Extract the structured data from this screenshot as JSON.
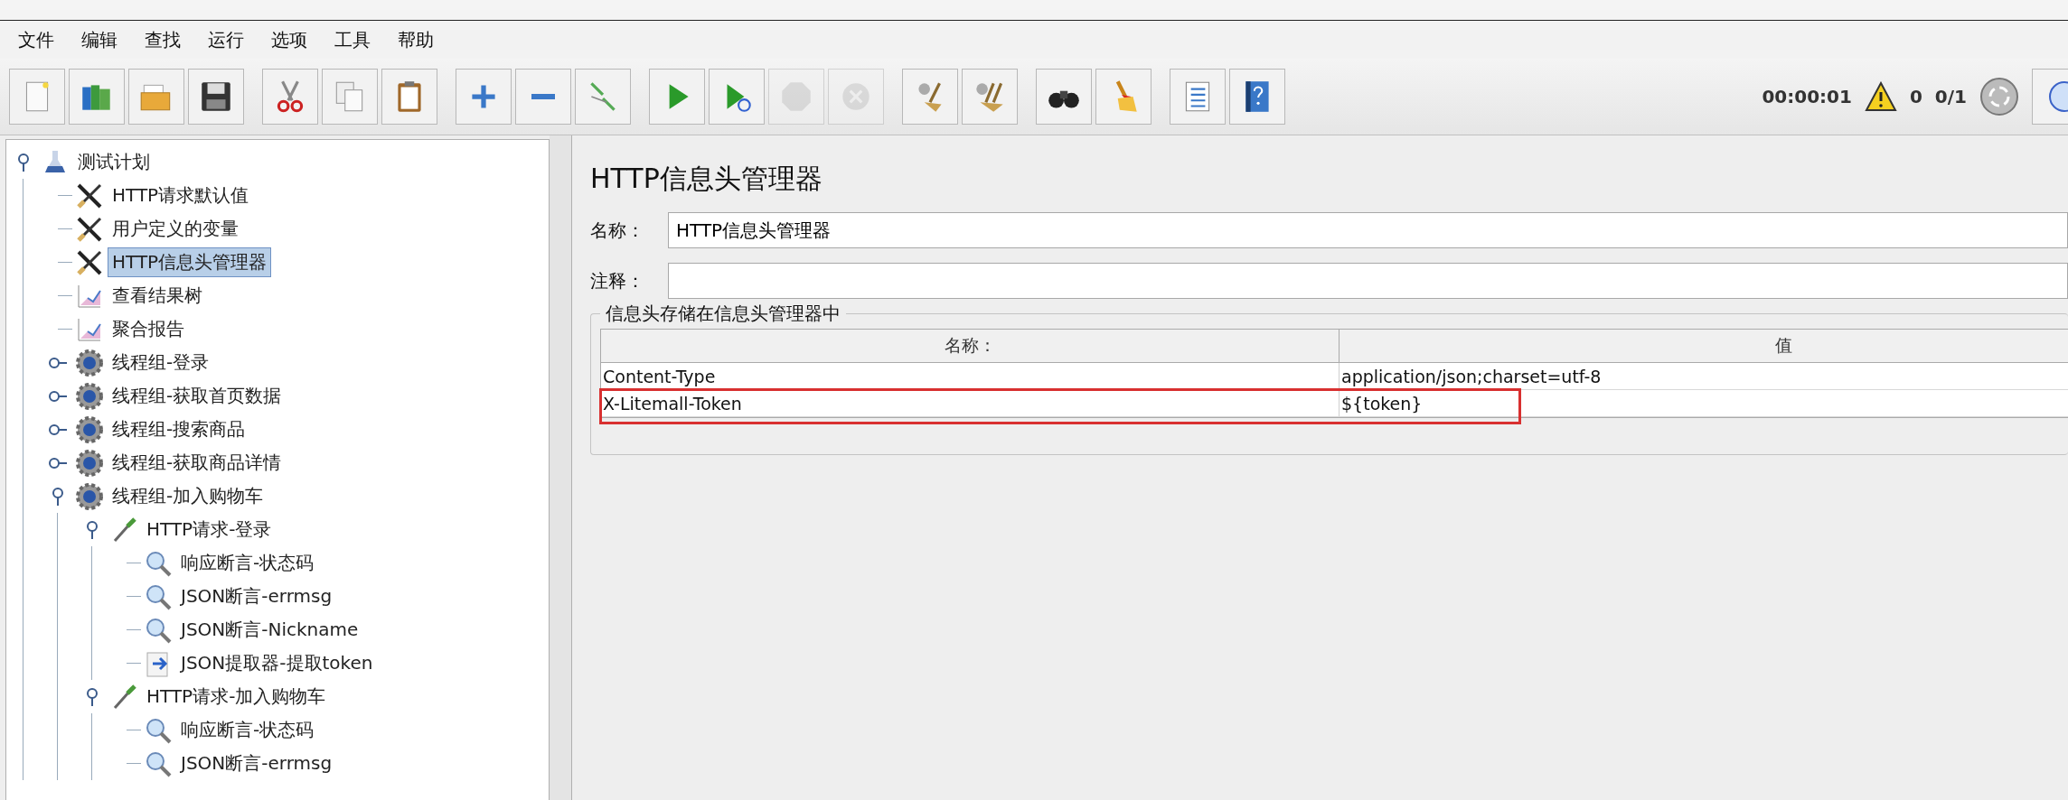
{
  "menu": [
    "文件",
    "编辑",
    "查找",
    "运行",
    "选项",
    "工具",
    "帮助"
  ],
  "toolbar": [
    [
      {
        "kind": "new",
        "disabled": false
      },
      {
        "kind": "templates",
        "disabled": false
      },
      {
        "kind": "open",
        "disabled": false
      },
      {
        "kind": "save",
        "disabled": false
      }
    ],
    [
      {
        "kind": "cut",
        "disabled": false
      },
      {
        "kind": "copy",
        "disabled": false
      },
      {
        "kind": "paste",
        "disabled": false
      }
    ],
    [
      {
        "kind": "expand",
        "disabled": false
      },
      {
        "kind": "collapse",
        "disabled": false
      },
      {
        "kind": "toggle",
        "disabled": false
      }
    ],
    [
      {
        "kind": "start",
        "disabled": false
      },
      {
        "kind": "start-no-pause",
        "disabled": false
      },
      {
        "kind": "stop",
        "disabled": true
      },
      {
        "kind": "shutdown",
        "disabled": true
      }
    ],
    [
      {
        "kind": "clear",
        "disabled": false
      },
      {
        "kind": "clear-all",
        "disabled": false
      }
    ],
    [
      {
        "kind": "search",
        "disabled": false
      },
      {
        "kind": "reset-search",
        "disabled": false
      }
    ],
    [
      {
        "kind": "function-helper",
        "disabled": false
      },
      {
        "kind": "help",
        "disabled": false
      }
    ]
  ],
  "status": {
    "elapsed": "00:00:01",
    "warnings": "0",
    "threads": "0/1"
  },
  "tree": [
    {
      "label": "测试计划",
      "kind": "plan",
      "selected": false,
      "expanded": true,
      "children": [
        {
          "label": "HTTP请求默认值",
          "kind": "config",
          "selected": false
        },
        {
          "label": "用户定义的变量",
          "kind": "config",
          "selected": false
        },
        {
          "label": "HTTP信息头管理器",
          "kind": "config",
          "selected": true
        },
        {
          "label": "查看结果树",
          "kind": "listener",
          "selected": false
        },
        {
          "label": "聚合报告",
          "kind": "listener",
          "selected": false
        },
        {
          "label": "线程组-登录",
          "kind": "thread-group",
          "selected": false,
          "expanded": false
        },
        {
          "label": "线程组-获取首页数据",
          "kind": "thread-group",
          "selected": false,
          "expanded": false
        },
        {
          "label": "线程组-搜索商品",
          "kind": "thread-group",
          "selected": false,
          "expanded": false
        },
        {
          "label": "线程组-获取商品详情",
          "kind": "thread-group",
          "selected": false,
          "expanded": false
        },
        {
          "label": "线程组-加入购物车",
          "kind": "thread-group",
          "selected": false,
          "expanded": true,
          "children": [
            {
              "label": "HTTP请求-登录",
              "kind": "sampler",
              "selected": false,
              "expanded": true,
              "children": [
                {
                  "label": "响应断言-状态码",
                  "kind": "assertion",
                  "selected": false
                },
                {
                  "label": "JSON断言-errmsg",
                  "kind": "assertion",
                  "selected": false
                },
                {
                  "label": "JSON断言-Nickname",
                  "kind": "assertion",
                  "selected": false
                },
                {
                  "label": "JSON提取器-提取token",
                  "kind": "extractor",
                  "selected": false
                }
              ]
            },
            {
              "label": "HTTP请求-加入购物车",
              "kind": "sampler",
              "selected": false,
              "expanded": true,
              "children": [
                {
                  "label": "响应断言-状态码",
                  "kind": "assertion",
                  "selected": false
                },
                {
                  "label": "JSON断言-errmsg",
                  "kind": "assertion",
                  "selected": false
                }
              ]
            }
          ]
        }
      ]
    }
  ],
  "panel": {
    "title": "HTTP信息头管理器",
    "fields": [
      {
        "label": "名称：",
        "value": "HTTP信息头管理器"
      },
      {
        "label": "注释："
      }
    ],
    "group_title": "信息头存储在信息头管理器中",
    "table": {
      "columns": [
        "名称：",
        "值"
      ],
      "rows": [
        {
          "cells": [
            "Content-Type",
            "application/json;charset=utf-8"
          ],
          "highlighted": false
        },
        {
          "cells": [
            "X-Litemall-Token",
            "${token}"
          ],
          "highlighted": true
        }
      ]
    }
  }
}
